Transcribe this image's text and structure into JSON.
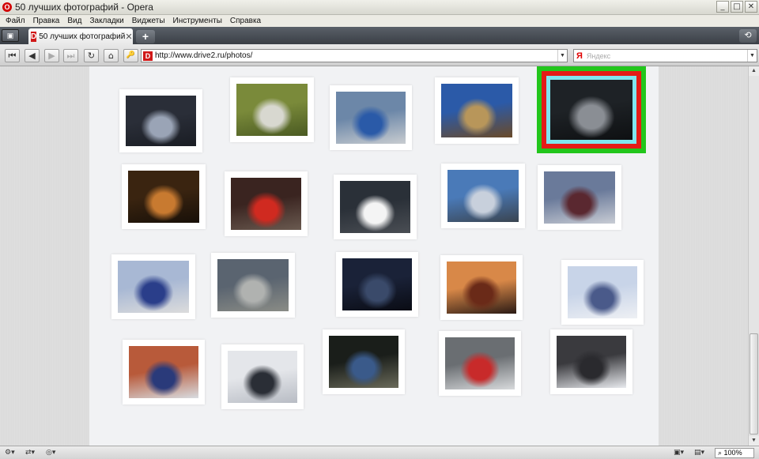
{
  "window": {
    "title": "50 лучших фотографий - Opera",
    "logo_letter": "O",
    "buttons": {
      "minimize": "_",
      "maximize": "□",
      "close": "✕"
    }
  },
  "menu": [
    "Файл",
    "Правка",
    "Вид",
    "Закладки",
    "Виджеты",
    "Инструменты",
    "Справка"
  ],
  "tabs": [
    {
      "label": "50 лучших фотографий",
      "favicon_letter": "D",
      "close": "✕"
    }
  ],
  "tabbar": {
    "new_tab": "+",
    "trash": "⟲",
    "panel": "▣"
  },
  "nav": {
    "buttons": {
      "rewind": "⏮",
      "back": "◀",
      "forward": "▶",
      "fast_forward": "⏭",
      "reload": "↻",
      "home": "⌂",
      "key": "🔑"
    },
    "url": "http://www.drive2.ru/photos/",
    "url_favicon_letter": "D",
    "search_engine": "Я",
    "search_placeholder": "Яндекс",
    "dropdown": "▼"
  },
  "thumbnails": [
    {
      "id": 1,
      "colors": [
        "#2a2e38",
        "#9aa4b6",
        "#1a1d24"
      ],
      "selected": false
    },
    {
      "id": 2,
      "colors": [
        "#7a8a3a",
        "#d8d8d0",
        "#4a5a22"
      ],
      "selected": false
    },
    {
      "id": 3,
      "colors": [
        "#6c87a8",
        "#2a5aa8",
        "#c8ccd0"
      ],
      "selected": false
    },
    {
      "id": 4,
      "colors": [
        "#2b5aa8",
        "#b8965a",
        "#6a4a28"
      ],
      "selected": false
    },
    {
      "id": 5,
      "colors": [
        "#1e2226",
        "#8a8e94",
        "#0e1012"
      ],
      "selected": true
    },
    {
      "id": 6,
      "colors": [
        "#3a2410",
        "#c87a30",
        "#181008"
      ],
      "selected": false
    },
    {
      "id": 7,
      "colors": [
        "#3a2420",
        "#d02a20",
        "#6a5a50"
      ],
      "selected": false
    },
    {
      "id": 8,
      "colors": [
        "#2a3038",
        "#f4f4f4",
        "#4a4e54"
      ],
      "selected": false
    },
    {
      "id": 9,
      "colors": [
        "#4a7ab8",
        "#c8d0dc",
        "#3a4450"
      ],
      "selected": false
    },
    {
      "id": 10,
      "colors": [
        "#6a7a9a",
        "#5a2830",
        "#c8ccd4"
      ],
      "selected": false
    },
    {
      "id": 11,
      "colors": [
        "#a8b8d4",
        "#2a3e8a",
        "#dcdcdc"
      ],
      "selected": false
    },
    {
      "id": 12,
      "colors": [
        "#5a6470",
        "#b0b2b0",
        "#8a8c86"
      ],
      "selected": false
    },
    {
      "id": 13,
      "colors": [
        "#1a2238",
        "#3a4a6a",
        "#0a0c14"
      ],
      "selected": false
    },
    {
      "id": 14,
      "colors": [
        "#d88848",
        "#6a2a18",
        "#2a1a14"
      ],
      "selected": false
    },
    {
      "id": 15,
      "colors": [
        "#c8d4e8",
        "#4a5a8a",
        "#eef0f4"
      ],
      "selected": false
    },
    {
      "id": 16,
      "colors": [
        "#b85a3a",
        "#2a3a7a",
        "#d8dce0"
      ],
      "selected": false
    },
    {
      "id": 17,
      "colors": [
        "#e4e6ea",
        "#2a2e36",
        "#b8bcc4"
      ],
      "selected": false
    },
    {
      "id": 18,
      "colors": [
        "#1a1e1a",
        "#3a5a8a",
        "#6a6a5a"
      ],
      "selected": false
    },
    {
      "id": 19,
      "colors": [
        "#6a6e72",
        "#c82a2a",
        "#d8dadc"
      ],
      "selected": false
    },
    {
      "id": 20,
      "colors": [
        "#3a3a3e",
        "#2a2a2e",
        "#e8eaee"
      ],
      "selected": false
    }
  ],
  "status": {
    "zoom": "100%"
  }
}
